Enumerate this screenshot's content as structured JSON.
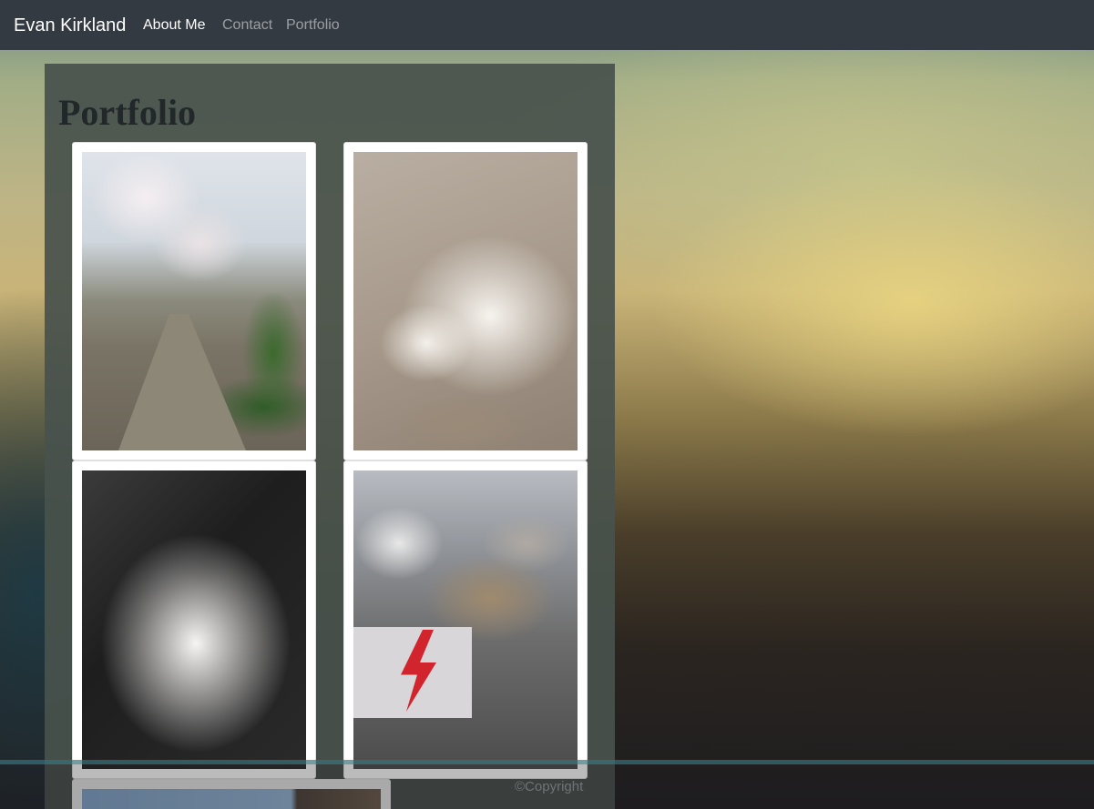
{
  "navbar": {
    "brand": "Evan Kirkland",
    "links": [
      {
        "label": "About Me",
        "active": true
      },
      {
        "label": "Contact",
        "active": false
      },
      {
        "label": "Portfolio",
        "active": false
      }
    ]
  },
  "main": {
    "title": "Portfolio",
    "photos": [
      {
        "subject": "park-path-photo"
      },
      {
        "subject": "dog-on-carpet-photo"
      },
      {
        "subject": "white-dog-photo"
      },
      {
        "subject": "street-planter-photo"
      },
      {
        "subject": "sky-photo"
      }
    ]
  },
  "footer": {
    "copyright": "©Copyright"
  },
  "colors": {
    "navbar_bg": "#343a42",
    "panel_bg": "#48524c",
    "title_color": "#22272a"
  }
}
